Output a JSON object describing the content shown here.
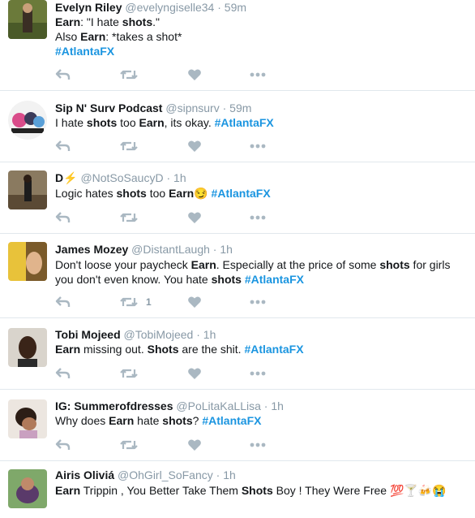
{
  "colors": {
    "hashtag": "#1b95e0",
    "meta": "#8899a6",
    "icon": "#aab8c2",
    "divider": "#e1e8ed"
  },
  "icons": [
    "reply-icon",
    "retweet-icon",
    "like-icon",
    "more-icon"
  ],
  "tweets": [
    {
      "name": "Evelyn Riley",
      "handle": "@evelyngiselle34",
      "dot": "·",
      "time": "59m",
      "lines": [
        "Earn: \"I hate shots.\"",
        "Also Earn: *takes a shot*",
        " #AtlantaFX"
      ],
      "retweets": ""
    },
    {
      "name": "Sip N' Surv Podcast",
      "handle": "@sipnsurv",
      "dot": "·",
      "time": "59m",
      "text": "I hate shots too Earn, its okay. #AtlantaFX",
      "retweets": ""
    },
    {
      "name": "D⚡",
      "handle": "@NotSoSaucyD",
      "dot": "·",
      "time": "1h",
      "text": "Logic hates shots too Earn😏 #AtlantaFX",
      "retweets": ""
    },
    {
      "name": "James Mozey",
      "handle": "@DistantLaugh",
      "dot": "·",
      "time": "1h",
      "text": "Don't loose your paycheck Earn. Especially at the price of some shots for girls you don't even know. You hate shots #AtlantaFX",
      "retweets": "1"
    },
    {
      "name": "Tobi Mojeed",
      "handle": "@TobiMojeed",
      "dot": "·",
      "time": "1h",
      "text": "Earn missing out. Shots are the shit.  #AtlantaFX",
      "retweets": ""
    },
    {
      "name": "IG: Summerofdresses",
      "handle": "@PoLitaKaLLisa",
      "dot": "·",
      "time": "1h",
      "text": "Why does Earn hate shots? #AtlantaFX",
      "retweets": ""
    },
    {
      "name": "Airis Oliviá",
      "handle": "@OhGirl_SoFancy",
      "dot": "·",
      "time": "1h",
      "text": "Earn Trippin , You Better Take Them Shots Boy ! They Were Free 💯🍸🍻😭",
      "retweets": ""
    }
  ]
}
